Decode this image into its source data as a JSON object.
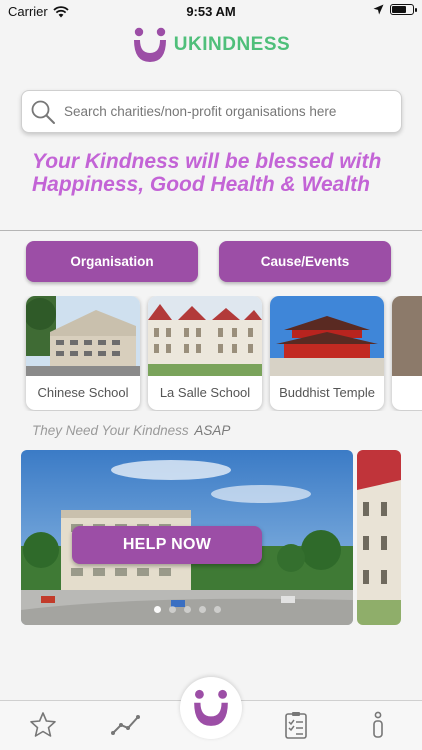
{
  "status_bar": {
    "carrier": "Carrier",
    "time": "9:53 AM"
  },
  "brand": {
    "name": "UKINDNESS",
    "color": "#4fbf7a",
    "logo_color": "#9c4ea6"
  },
  "search": {
    "placeholder": "Search charities/non-profit organisations here",
    "icon": "search-icon"
  },
  "tagline": "Your Kindness will be blessed with Happiness, Good Health & Wealth",
  "filter_buttons": {
    "organisation": "Organisation",
    "cause_events": "Cause/Events"
  },
  "categories": [
    {
      "label": "Chinese School"
    },
    {
      "label": "La Salle School"
    },
    {
      "label": "Buddhist Temple"
    }
  ],
  "need": {
    "text": "They Need Your Kindness",
    "highlight": "ASAP"
  },
  "banner": {
    "button": "HELP NOW",
    "slide_count": 5,
    "active_slide": 1
  },
  "tabbar": {
    "items": [
      "star-icon",
      "chart-icon",
      "home-icon",
      "checklist-icon",
      "info-icon"
    ]
  },
  "colors": {
    "accent": "#9c4ea6",
    "tagline": "#c364d6"
  }
}
